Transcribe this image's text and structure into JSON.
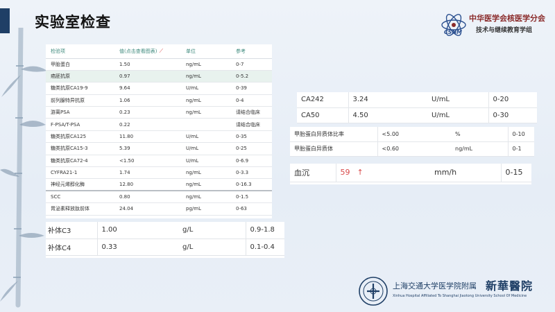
{
  "page": {
    "title": "实验室检查"
  },
  "society": {
    "name_line1": "中华医学会核医学分会",
    "name_line2": "技术与继续教育学组",
    "abbr": "CSNM"
  },
  "lab_table": {
    "headers": {
      "item": "检验项",
      "value": "值(点击查看图表)",
      "unit": "单位",
      "reference": "参考"
    },
    "rows": [
      {
        "item": "甲胎蛋白",
        "value": "1.50",
        "unit": "ng/mL",
        "reference": "0-7"
      },
      {
        "item": "癌胚抗原",
        "value": "0.97",
        "unit": "ng/mL",
        "reference": "0-5.2"
      },
      {
        "item": "糖类抗原CA19-9",
        "value": "9.64",
        "unit": "U/mL",
        "reference": "0-39"
      },
      {
        "item": "前列腺特异抗原",
        "value": "1.06",
        "unit": "ng/mL",
        "reference": "0-4"
      },
      {
        "item": "游离PSA",
        "value": "0.23",
        "unit": "ng/mL",
        "reference": "请结合临床"
      },
      {
        "item": "F-PSA/T-PSA",
        "value": "0.22",
        "unit": "",
        "reference": "请结合临床"
      },
      {
        "item": "糖类抗原CA125",
        "value": "11.80",
        "unit": "U/mL",
        "reference": "0-35"
      },
      {
        "item": "糖类抗原CA15-3",
        "value": "5.39",
        "unit": "U/mL",
        "reference": "0-25"
      },
      {
        "item": "糖类抗原CA72-4",
        "value": "<1.50",
        "unit": "U/mL",
        "reference": "0-6.9"
      },
      {
        "item": "CYFRA21-1",
        "value": "1.74",
        "unit": "ng/mL",
        "reference": "0-3.3"
      },
      {
        "item": "神经元烯醇化酶",
        "value": "12.80",
        "unit": "ng/mL",
        "reference": "0-16.3"
      },
      {
        "item": "SCC",
        "value": "0.80",
        "unit": "ng/mL",
        "reference": "0-1.5"
      },
      {
        "item": "胃泌素释放肽前体",
        "value": "24.04",
        "unit": "pg/mL",
        "reference": "0-63"
      }
    ]
  },
  "complement_table": {
    "rows": [
      {
        "item": "补体C3",
        "value": "1.00",
        "unit": "g/L",
        "reference": "0.9-1.8"
      },
      {
        "item": "补体C4",
        "value": "0.33",
        "unit": "g/L",
        "reference": "0.1-0.4"
      }
    ]
  },
  "ca_table": {
    "rows": [
      {
        "item": "CA242",
        "value": "3.24",
        "unit": "U/mL",
        "reference": "0-20"
      },
      {
        "item": "CA50",
        "value": "4.50",
        "unit": "U/mL",
        "reference": "0-30"
      }
    ]
  },
  "afp_table": {
    "rows": [
      {
        "item": "甲胎蛋白异质体比率",
        "value": "<5.00",
        "unit": "%",
        "reference": "0-10"
      },
      {
        "item": "甲胎蛋白异质体",
        "value": "<0.60",
        "unit": "ng/mL",
        "reference": "0-1"
      }
    ]
  },
  "esr": {
    "item": "血沉",
    "value": "59",
    "flag": "↑",
    "unit": "mm/h",
    "reference": "0-15"
  },
  "hospital": {
    "name_cn": "上海交通大学医学院附属",
    "brand": "新華醫院",
    "name_en": "Xinhua Hospital Affiliated To Shanghai Jiaotong University School Of Medicine"
  },
  "colors": {
    "header_text": "#3f8a7d",
    "highlight_row": "#e8f2ee",
    "abnormal": "#d94a4a",
    "brand_blue": "#1f3f66"
  }
}
